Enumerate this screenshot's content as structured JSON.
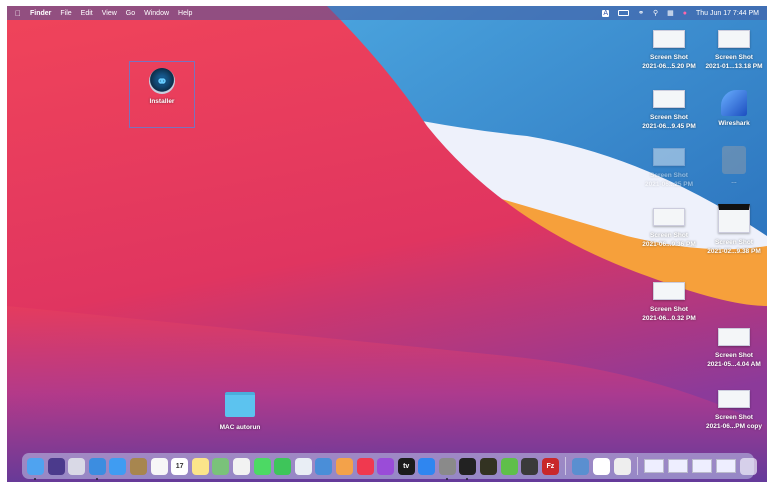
{
  "menubar": {
    "apple": "",
    "items": [
      "Finder",
      "File",
      "Edit",
      "View",
      "Go",
      "Window",
      "Help"
    ],
    "status_icons": [
      "input-source-icon",
      "battery-icon",
      "wifi-icon",
      "spotlight-icon",
      "control-center-icon",
      "siri-icon"
    ],
    "input_source": "A",
    "clock": "Thu Jun 17  7:44 PM"
  },
  "desktop": {
    "installer": {
      "label": "Installer"
    },
    "folder": {
      "label": "MAC autorun"
    },
    "files": [
      {
        "line1": "Screen Shot",
        "line2": "2021-06...5.20 PM"
      },
      {
        "line1": "Screen Shot",
        "line2": "2021-01...13.18 PM"
      },
      {
        "line1": "Screen Shot",
        "line2": "2021-06...9.45 PM"
      },
      {
        "line1": "Wireshark",
        "line2": ""
      },
      {
        "line1": "Screen Shot",
        "line2": "2021-06...25 PM"
      },
      {
        "line1": "...",
        "line2": ""
      },
      {
        "line1": "Screen Shot",
        "line2": "2021-06...9.36 PM"
      },
      {
        "line1": "Screen Shot",
        "line2": "2021-02...9.38 PM"
      },
      {
        "line1": "Screen Shot",
        "line2": "2021-06...0.32 PM"
      },
      {
        "line1": "Screen Shot",
        "line2": "2021-05...4.04 AM"
      },
      {
        "line1": "Screen Shot",
        "line2": "2021-06...PM copy"
      }
    ]
  },
  "dock": {
    "apps": [
      {
        "icon": "finder-icon",
        "color": "#4fa3f0",
        "running": true
      },
      {
        "icon": "siri-icon",
        "color": "#4b3a8c"
      },
      {
        "icon": "launchpad-icon",
        "color": "#d9d9e6"
      },
      {
        "icon": "safari-icon",
        "color": "#3c8de0",
        "running": true
      },
      {
        "icon": "mail-icon",
        "color": "#3f9cf2"
      },
      {
        "icon": "contacts-icon",
        "color": "#a7864f"
      },
      {
        "icon": "reminders-icon",
        "color": "#f7f7f7"
      },
      {
        "icon": "calendar-icon",
        "color": "#ffffff",
        "text": "17"
      },
      {
        "icon": "notes-icon",
        "color": "#fbe58a"
      },
      {
        "icon": "maps-icon",
        "color": "#7ac27a"
      },
      {
        "icon": "photos-icon",
        "color": "#f2f2f2"
      },
      {
        "icon": "messages-icon",
        "color": "#4cd964"
      },
      {
        "icon": "facetime-icon",
        "color": "#3ec55a"
      },
      {
        "icon": "numbers-icon",
        "color": "#e9eef5"
      },
      {
        "icon": "keynote-icon",
        "color": "#4a8ed8"
      },
      {
        "icon": "pages-icon",
        "color": "#f3a24a"
      },
      {
        "icon": "music-icon",
        "color": "#f0394f"
      },
      {
        "icon": "podcasts-icon",
        "color": "#9a4cd8"
      },
      {
        "icon": "apple-tv-icon",
        "color": "#1c1c1c",
        "text": "tv"
      },
      {
        "icon": "app-store-icon",
        "color": "#2f86f0"
      },
      {
        "icon": "system-preferences-icon",
        "color": "#8a8a8a",
        "running": true
      },
      {
        "icon": "terminal-icon",
        "color": "#222222",
        "running": true
      },
      {
        "icon": "console-icon",
        "color": "#333322"
      },
      {
        "icon": "green-app-icon",
        "color": "#5fbf4a"
      },
      {
        "icon": "dark-app-icon",
        "color": "#3a3a3a"
      },
      {
        "icon": "filezilla-icon",
        "color": "#c8282a",
        "text": "Fz"
      }
    ],
    "extras": [
      {
        "icon": "preview-icon",
        "color": "#5a8fd0"
      },
      {
        "icon": "chrome-icon",
        "color": "#ffffff"
      },
      {
        "icon": "utility-icon",
        "color": "#eeeeee"
      }
    ],
    "minimized_windows": 4,
    "trash": {
      "icon": "trash-icon"
    }
  }
}
